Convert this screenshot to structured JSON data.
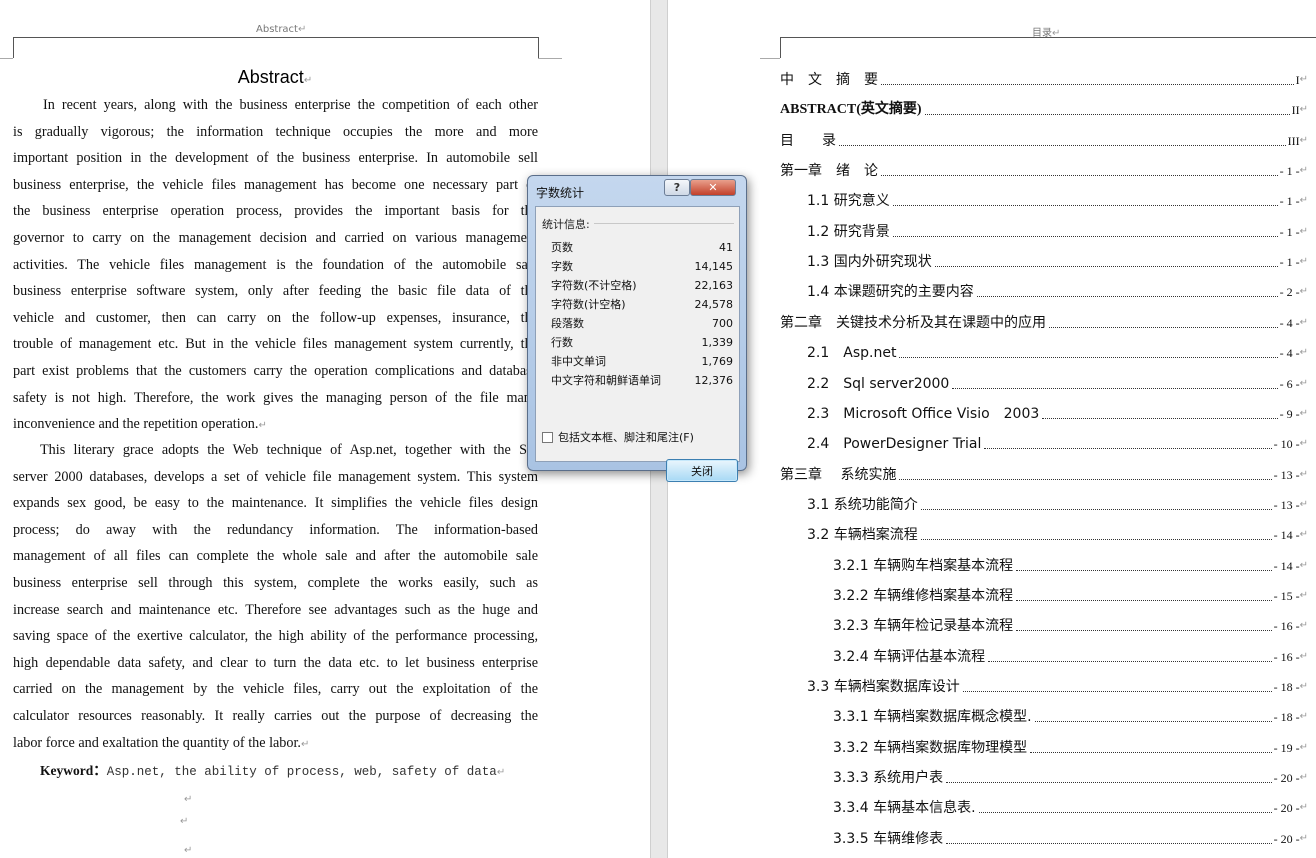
{
  "left_page": {
    "header": "Abstract",
    "title": "Abstract",
    "paragraph1": [
      "In recent years, along with the business enterprise the competition of each other",
      "is gradually vigorous; the information technique occupies the more and more",
      "important position in the development of the business enterprise. In automobile sell",
      "business enterprise, the vehicle files management has become one necessary part of",
      "the business enterprise operation process, provides the important basis for the",
      "governor to carry on the management decision and carried on various management",
      "activities. The vehicle files management is the foundation of the automobile sale",
      "business enterprise software system, only after feeding the basic file data of the",
      "vehicle and customer, then can carry on the follow-up expenses, insurance, the",
      "trouble of management etc. But in the vehicle files management system currently, the",
      "part exist problems that the customers carry the operation complications and database",
      "safety is not high. Therefore, the work gives the managing person of the file many",
      "inconvenience and the repetition operation."
    ],
    "paragraph2": [
      "This literary grace adopts the Web technique of Asp.net, together with the Sql",
      "server 2000 databases, develops a set of vehicle file management system. This system",
      "expands sex good, be easy to the maintenance. It simplifies the vehicle files design",
      "process; do away with the redundancy information. The information-based",
      "management of all files can complete the whole sale and after the automobile sale",
      "business enterprise sell through this system, complete the works easily, such as",
      "increase search and maintenance etc. Therefore see advantages such as the huge and",
      "saving space of the exertive calculator, the high ability of the performance processing,",
      "high dependable data safety, and clear to turn the data etc. to let business enterprise",
      "carried on the management by the vehicle files, carry out the exploitation of the",
      "calculator resources reasonably. It really carries out the purpose of decreasing the",
      "labor force and exaltation the quantity of the labor."
    ],
    "keyword_label": "Keyword：",
    "keyword_text": "Asp.net, the ability of process, web, safety of data"
  },
  "right_page": {
    "header": "目录",
    "toc": [
      {
        "label": "中　文　摘　要",
        "page": "I",
        "level": 0
      },
      {
        "label": "ABSTRACT(英文摘要)",
        "page": "II",
        "level": 0
      },
      {
        "label": "目　　录",
        "page": "III",
        "level": 0
      },
      {
        "label": "第一章　绪　论",
        "page": "- 1 -",
        "level": 0
      },
      {
        "label": "1.1 研究意义",
        "page": "- 1 -",
        "level": 1
      },
      {
        "label": "1.2 研究背景",
        "page": "- 1 -",
        "level": 1
      },
      {
        "label": "1.3 国内外研究现状",
        "page": "- 1 -",
        "level": 1
      },
      {
        "label": "1.4 本课题研究的主要内容",
        "page": "- 2 -",
        "level": 1
      },
      {
        "label": "第二章　关键技术分析及其在课题中的应用",
        "page": "- 4 -",
        "level": 0
      },
      {
        "label": "2.1　Asp.net",
        "page": "- 4 -",
        "level": 1
      },
      {
        "label": "2.2　Sql server2000",
        "page": "- 6 -",
        "level": 1
      },
      {
        "label": "2.3　Microsoft Office Visio　2003",
        "page": "- 9 -",
        "level": 1
      },
      {
        "label": "2.4　PowerDesigner Trial",
        "page": "- 10 -",
        "level": 1
      },
      {
        "label": "第三章　 系统实施",
        "page": "- 13 -",
        "level": 0
      },
      {
        "label": "3.1 系统功能简介",
        "page": "- 13 -",
        "level": 1
      },
      {
        "label": "3.2 车辆档案流程",
        "page": "- 14 -",
        "level": 1
      },
      {
        "label": "3.2.1 车辆购车档案基本流程",
        "page": "- 14 -",
        "level": 2
      },
      {
        "label": "3.2.2 车辆维修档案基本流程",
        "page": "- 15 -",
        "level": 2
      },
      {
        "label": "3.2.3 车辆年检记录基本流程",
        "page": "- 16 -",
        "level": 2
      },
      {
        "label": "3.2.4 车辆评估基本流程",
        "page": "- 16 -",
        "level": 2
      },
      {
        "label": "3.3 车辆档案数据库设计",
        "page": "- 18 -",
        "level": 1
      },
      {
        "label": "3.3.1 车辆档案数据库概念模型.",
        "page": "- 18 -",
        "level": 2
      },
      {
        "label": "3.3.2 车辆档案数据库物理模型",
        "page": "- 19 -",
        "level": 2
      },
      {
        "label": "3.3.3 系统用户表",
        "page": "- 20 -",
        "level": 2
      },
      {
        "label": "3.3.4 车辆基本信息表.",
        "page": "- 20 -",
        "level": 2
      },
      {
        "label": "3.3.5 车辆维修表",
        "page": "- 20 -",
        "level": 2
      }
    ]
  },
  "dialog": {
    "title": "字数统计",
    "help_label": "?",
    "close_x_label": "✕",
    "section_label": "统计信息:",
    "stats": [
      {
        "label": "页数",
        "value": "41"
      },
      {
        "label": "字数",
        "value": "14,145"
      },
      {
        "label": "字符数(不计空格)",
        "value": "22,163"
      },
      {
        "label": "字符数(计空格)",
        "value": "24,578"
      },
      {
        "label": "段落数",
        "value": "700"
      },
      {
        "label": "行数",
        "value": "1,339"
      },
      {
        "label": "非中文单词",
        "value": "1,769"
      },
      {
        "label": "中文字符和朝鲜语单词",
        "value": "12,376"
      }
    ],
    "checkbox_label": "包括文本框、脚注和尾注(F)",
    "checkbox_checked": false,
    "close_button": "关闭"
  },
  "paragraph_mark": "↵"
}
